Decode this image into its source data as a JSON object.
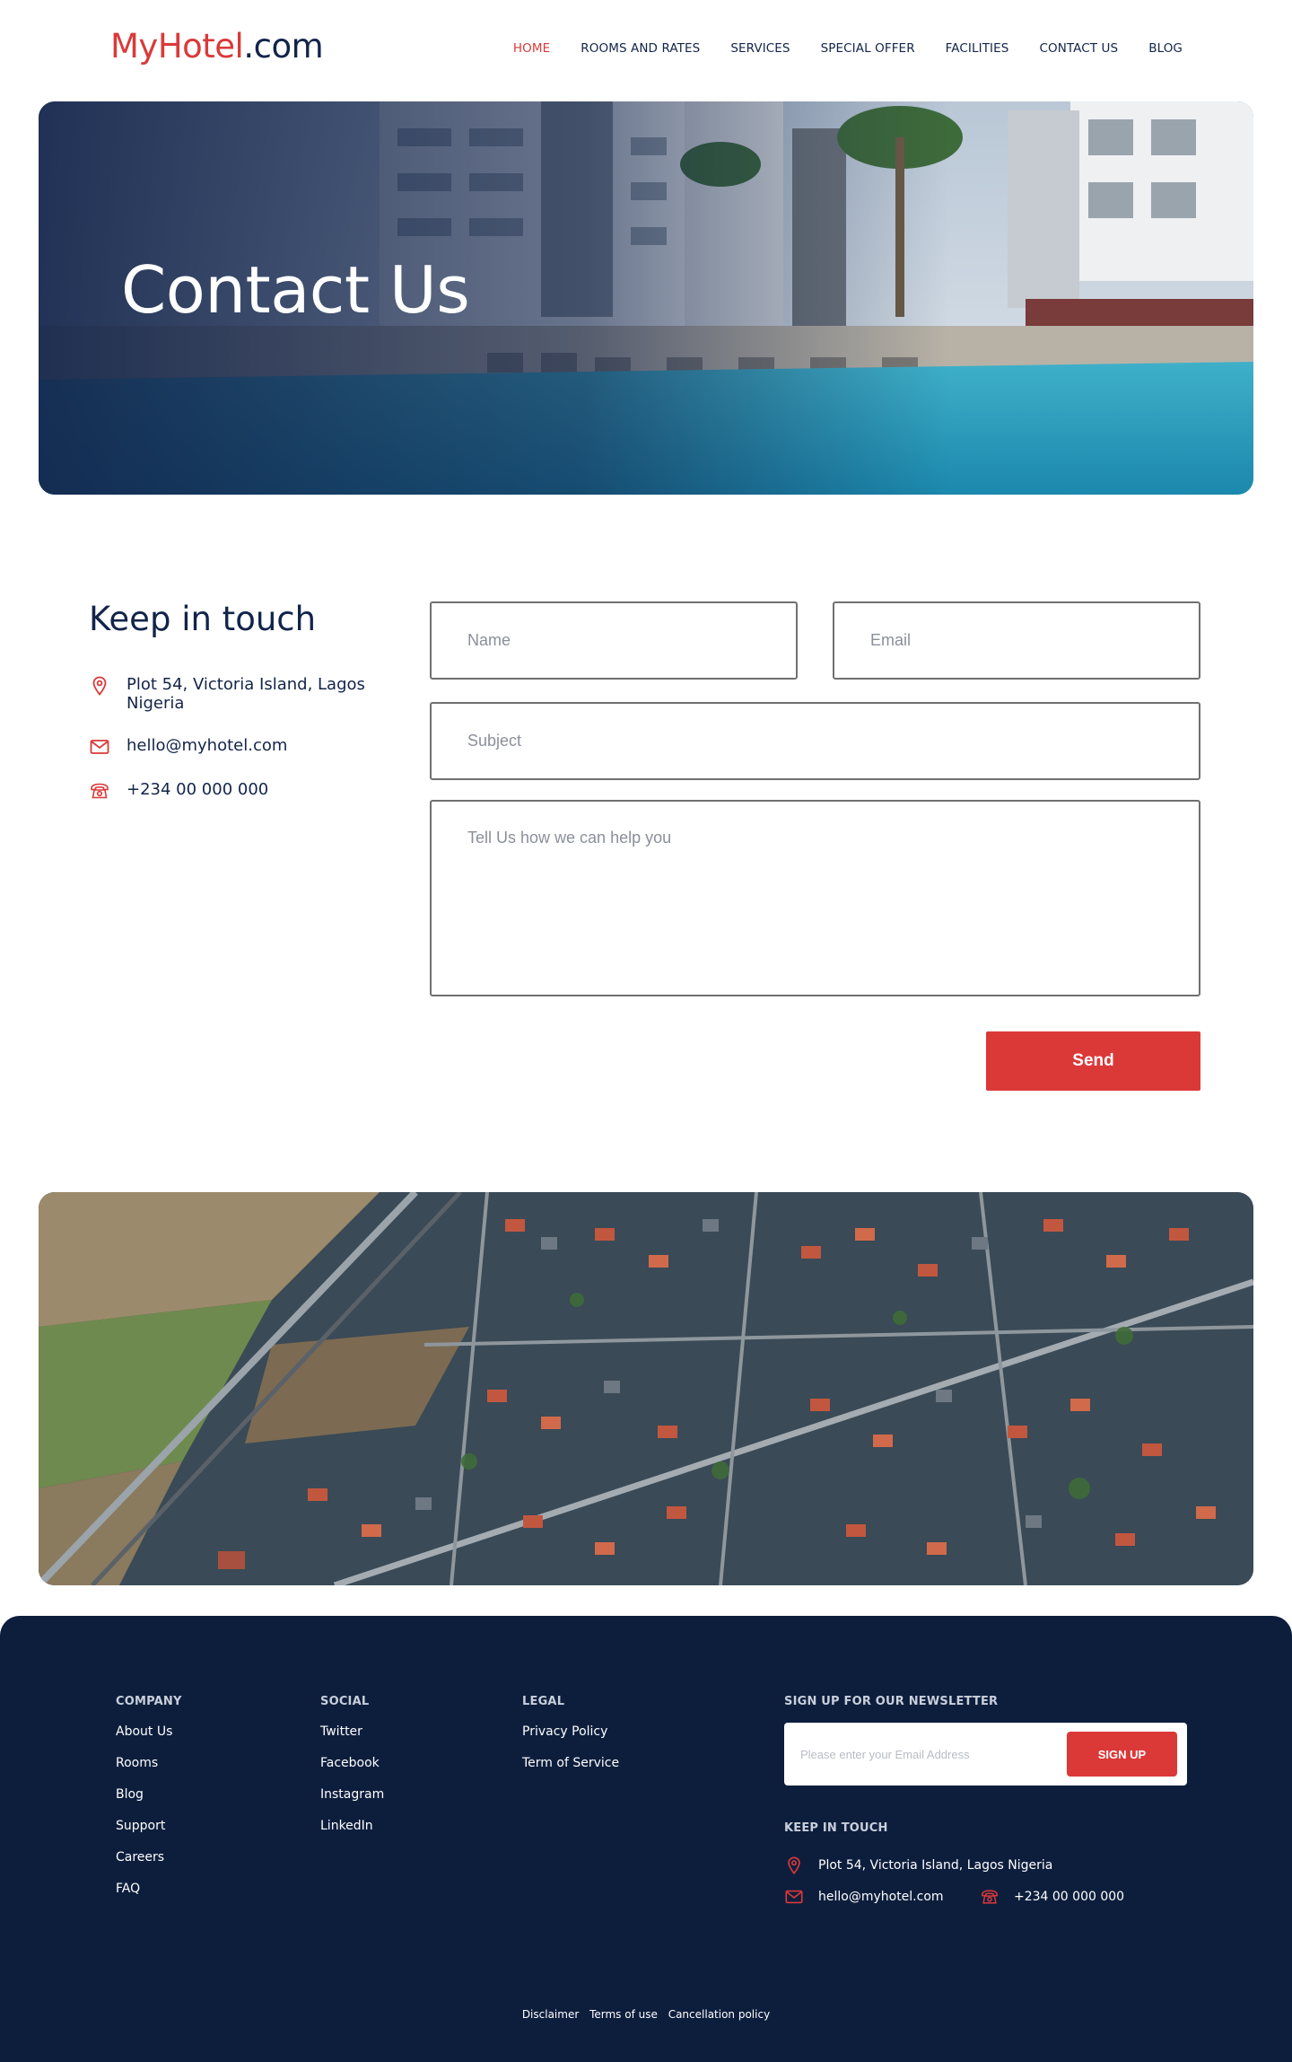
{
  "header": {
    "logo_brand": "MyHotel",
    "logo_tld": ".com",
    "nav": [
      {
        "label": "HOME",
        "active": true
      },
      {
        "label": "ROOMS AND RATES"
      },
      {
        "label": "SERVICES"
      },
      {
        "label": "SPECIAL OFFER"
      },
      {
        "label": "FACILITIES"
      },
      {
        "label": "CONTACT US"
      },
      {
        "label": "BLOG"
      }
    ]
  },
  "hero": {
    "title": "Contact Us"
  },
  "contact": {
    "title": "Keep in touch",
    "address": "Plot 54, Victoria Island, Lagos Nigeria",
    "email": "hello@myhotel.com",
    "phone": "+234 00 000 000",
    "form": {
      "name_placeholder": "Name",
      "email_placeholder": "Email",
      "subject_placeholder": "Subject",
      "message_placeholder": "Tell Us how we can help you",
      "send_label": "Send"
    }
  },
  "footer": {
    "company": {
      "heading": "COMPANY",
      "links": [
        "About Us",
        "Rooms",
        "Blog",
        "Support",
        "Careers",
        "FAQ"
      ]
    },
    "social": {
      "heading": "SOCIAL",
      "links": [
        "Twitter",
        "Facebook",
        "Instagram",
        "LinkedIn"
      ]
    },
    "legal": {
      "heading": "LEGAL",
      "links": [
        "Privacy Policy",
        "Term of Service"
      ]
    },
    "newsletter": {
      "heading": "SIGN UP FOR OUR NEWSLETTER",
      "placeholder": "Please enter your Email Address",
      "button": "SIGN UP"
    },
    "keep_in_touch": {
      "heading": "KEEP IN TOUCH",
      "address": "Plot 54, Victoria Island, Lagos Nigeria",
      "email": "hello@myhotel.com",
      "phone": "+234 00 000 000"
    },
    "bottom_links": [
      "Disclaimer",
      "Terms of use",
      "Cancellation policy"
    ]
  },
  "colors": {
    "accent": "#db3838",
    "navy": "#0d1e3d",
    "text": "#13244a"
  }
}
